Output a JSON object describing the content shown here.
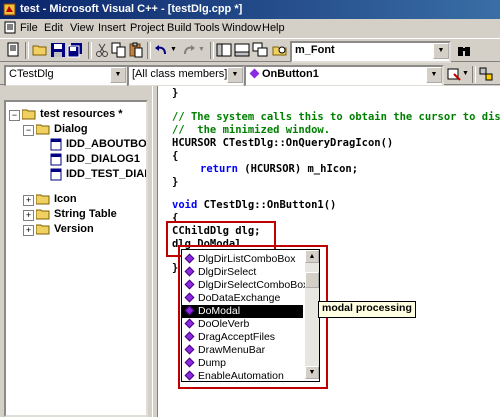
{
  "window": {
    "title": "test - Microsoft Visual C++ - [testDlg.cpp *]"
  },
  "menu": [
    "File",
    "Edit",
    "View",
    "Insert",
    "Project",
    "Build",
    "Tools",
    "Window",
    "Help"
  ],
  "toolbar": {
    "find_value": "m_Font"
  },
  "wizardbar": {
    "class": "CTestDlg",
    "filter": "[All class members]",
    "member": "OnButton1"
  },
  "tree": {
    "root": "test resources *",
    "dialog": "Dialog",
    "dialog_items": [
      "IDD_ABOUTBOX",
      "IDD_DIALOG1",
      "IDD_TEST_DIALOG"
    ],
    "folders": [
      "Icon",
      "String Table",
      "Version"
    ]
  },
  "code": {
    "l1": "}",
    "l2": "// The system calls this to obtain the cursor to display while the user drags",
    "l3": "//  the minimized window.",
    "l4": "HCURSOR CTestDlg::OnQueryDragIcon()",
    "l5": "{",
    "l6_kw": "return",
    "l6_rest": " (HCURSOR) m_hIcon;",
    "l7": "}",
    "l8_kw": "void",
    "l8_rest": " CTestDlg::OnButton1()",
    "l9": "{",
    "l10": "CChildDlg dlg;",
    "l11": "dlg.DoModal",
    "l12": "}"
  },
  "autocomplete": {
    "items": [
      "DlgDirListComboBox",
      "DlgDirSelect",
      "DlgDirSelectComboBox",
      "DoDataExchange",
      "DoModal",
      "DoOleVerb",
      "DragAcceptFiles",
      "DrawMenuBar",
      "Dump",
      "EnableAutomation"
    ],
    "selected": "DoModal",
    "tooltip": "modal processing"
  },
  "colors": {
    "highlight_box": "#c00000",
    "keyword": "#0000ff",
    "comment": "#008000",
    "title_bar": "#0a246a"
  }
}
